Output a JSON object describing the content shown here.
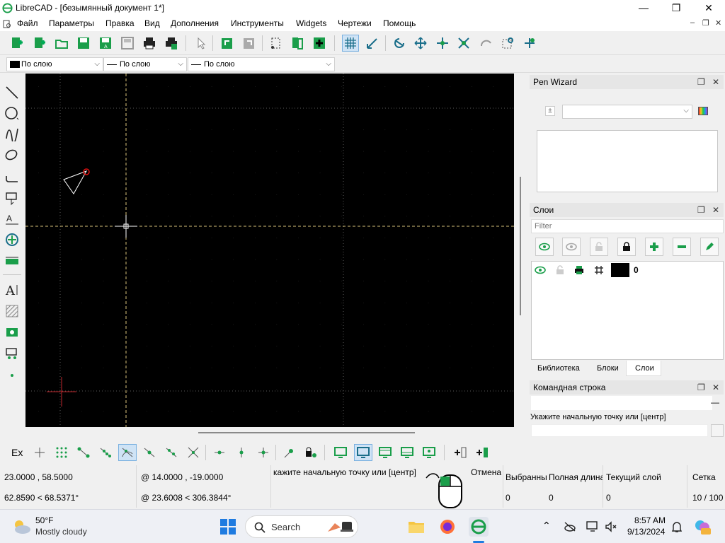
{
  "window": {
    "title": "LibreCAD - [безымянный документ 1*]",
    "minimize_glyph": "—",
    "maximize_glyph": "❐",
    "close_glyph": "✕"
  },
  "menubar": {
    "items": [
      "Файл",
      "Параметры",
      "Правка",
      "Вид",
      "Дополнения",
      "Инструменты",
      "Widgets",
      "Чертежи",
      "Помощь"
    ],
    "mdi_controls": [
      "–",
      "❐",
      "✕"
    ]
  },
  "pen_toolbar": {
    "color": "По слою",
    "line_width": "По слою",
    "line_type": "По слою"
  },
  "pen_wizard": {
    "title": "Pen Wizard",
    "sort_glyph": "±",
    "combo_value": ""
  },
  "layers": {
    "title": "Слои",
    "filter_placeholder": "Filter",
    "rows": [
      {
        "name": "0",
        "color": "#000000"
      }
    ]
  },
  "dock_tabs": {
    "items": [
      "Библиотека",
      "Блоки",
      "Слои"
    ],
    "active": "Слои"
  },
  "command_line": {
    "title": "Командная строка",
    "history": "Укажите начальную точку или [центр]",
    "input_value": ""
  },
  "snap_toolbar": {
    "ex_label": "Ex"
  },
  "status": {
    "abs_coord": "23.0000 , 58.5000",
    "abs_polar": "62.8590 < 68.5371°",
    "rel_coord": "@  14.0000 , -19.0000",
    "rel_polar": "@  23.6008 < 306.3844°",
    "prompt": "кажите начальную точку или [центр]",
    "cancel": "Отмена",
    "selected_label": "Выбранны",
    "selected_value": "0",
    "total_length_label": "Полная длина",
    "total_length_value": "0",
    "current_layer_label": "Текущий слой",
    "current_layer_value": "0",
    "grid_label": "Сетка",
    "grid_value": "10 / 100"
  },
  "taskbar": {
    "weather_temp": "50°F",
    "weather_desc": "Mostly cloudy",
    "search_label": "Search",
    "time": "8:57 AM",
    "date": "9/13/2024"
  },
  "colors": {
    "accent_green": "#1a9e4a",
    "canvas_bg": "#000000",
    "selected_blue": "#cfe3f5"
  }
}
